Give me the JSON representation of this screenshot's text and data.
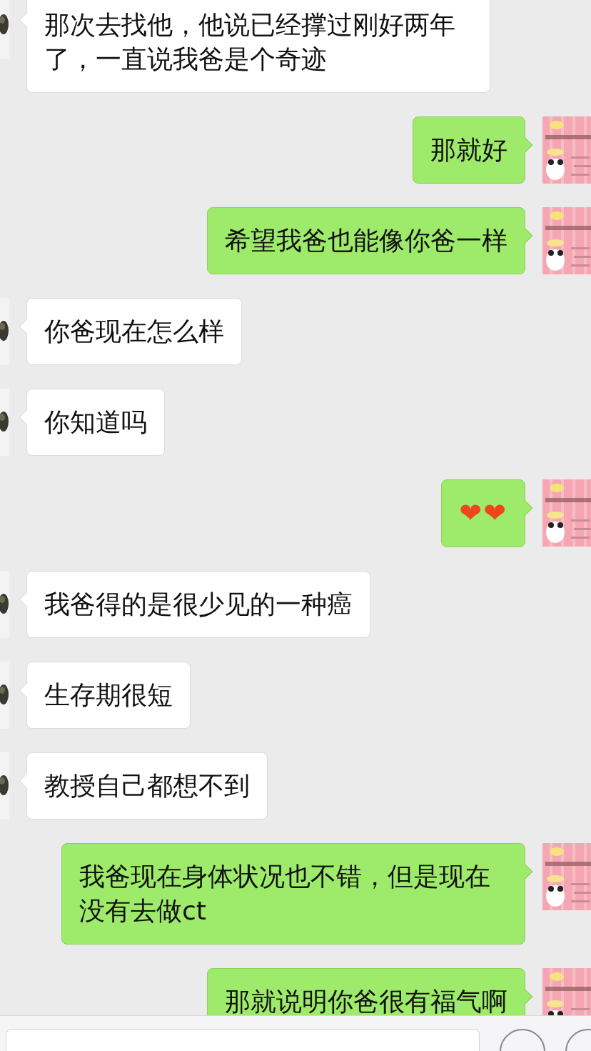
{
  "messages": [
    {
      "outgoing": false,
      "kind": "text",
      "text": "那次去找他，他说已经撑过刚好两年了，一直说我爸是个奇迹"
    },
    {
      "outgoing": true,
      "kind": "text",
      "text": "那就好"
    },
    {
      "outgoing": true,
      "kind": "text",
      "text": "希望我爸也能像你爸一样"
    },
    {
      "outgoing": false,
      "kind": "text",
      "text": "你爸现在怎么样"
    },
    {
      "outgoing": false,
      "kind": "text",
      "text": "你知道吗"
    },
    {
      "outgoing": true,
      "kind": "emoji",
      "text": "❤❤"
    },
    {
      "outgoing": false,
      "kind": "text",
      "text": "我爸得的是很少见的一种癌"
    },
    {
      "outgoing": false,
      "kind": "text",
      "text": "生存期很短"
    },
    {
      "outgoing": false,
      "kind": "text",
      "text": "教授自己都想不到"
    },
    {
      "outgoing": true,
      "kind": "text",
      "text": "我爸现在身体状况也不错，但是现在没有去做ct"
    },
    {
      "outgoing": true,
      "kind": "text",
      "text": "那就说明你爸很有福气啊"
    }
  ]
}
